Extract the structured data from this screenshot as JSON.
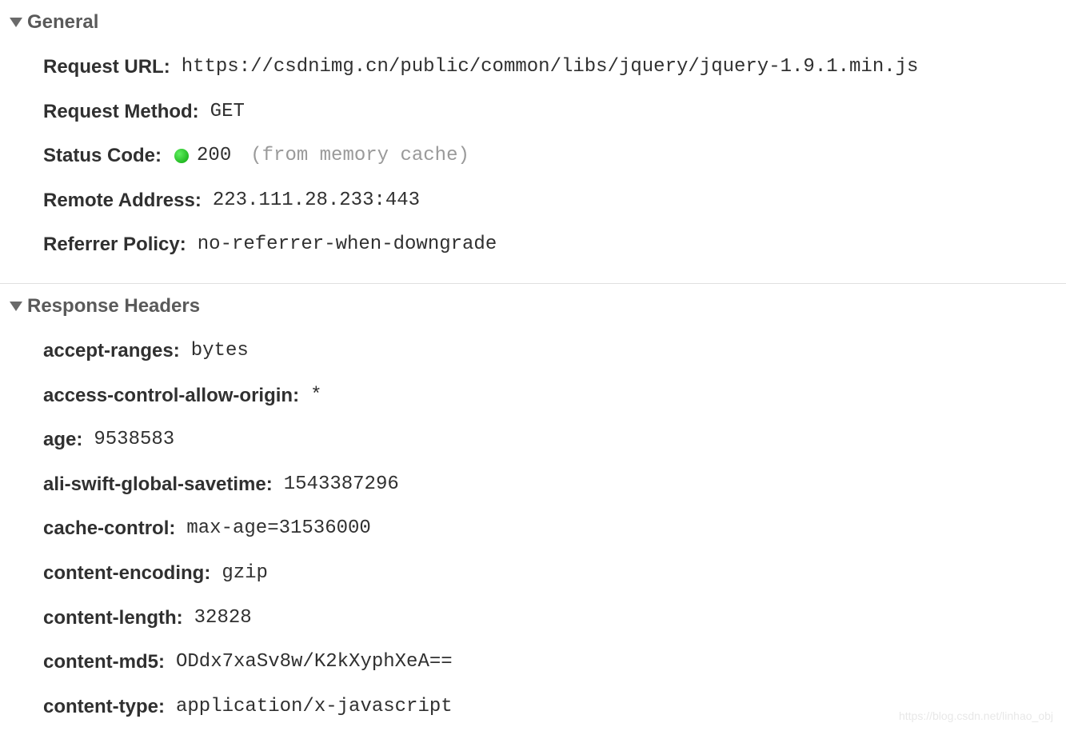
{
  "sections": {
    "general": {
      "title": "General",
      "items": [
        {
          "label": "Request URL",
          "value": "https://csdnimg.cn/public/common/libs/jquery/jquery-1.9.1.min.js"
        },
        {
          "label": "Request Method",
          "value": "GET"
        },
        {
          "label": "Status Code",
          "value": "200",
          "note": "(from memory cache)",
          "status_color": "green"
        },
        {
          "label": "Remote Address",
          "value": "223.111.28.233:443"
        },
        {
          "label": "Referrer Policy",
          "value": "no-referrer-when-downgrade"
        }
      ]
    },
    "response_headers": {
      "title": "Response Headers",
      "items": [
        {
          "label": "accept-ranges",
          "value": "bytes"
        },
        {
          "label": "access-control-allow-origin",
          "value": "*"
        },
        {
          "label": "age",
          "value": "9538583"
        },
        {
          "label": "ali-swift-global-savetime",
          "value": "1543387296"
        },
        {
          "label": "cache-control",
          "value": "max-age=31536000"
        },
        {
          "label": "content-encoding",
          "value": "gzip"
        },
        {
          "label": "content-length",
          "value": "32828"
        },
        {
          "label": "content-md5",
          "value": "ODdx7xaSv8w/K2kXyphXeA=="
        },
        {
          "label": "content-type",
          "value": "application/x-javascript"
        }
      ]
    }
  },
  "watermark": "https://blog.csdn.net/linhao_obj"
}
